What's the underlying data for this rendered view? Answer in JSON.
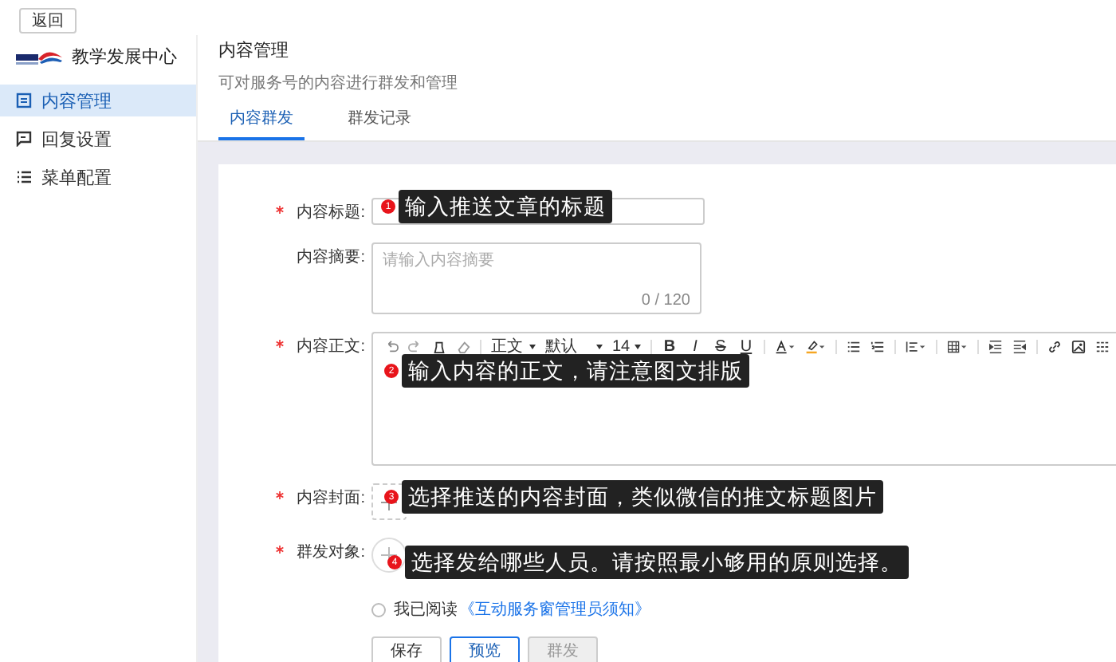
{
  "back_button": "返回",
  "brand": {
    "name": "教学发展中心"
  },
  "sidebar": {
    "items": [
      {
        "label": "内容管理",
        "selected": true
      },
      {
        "label": "回复设置",
        "selected": false
      },
      {
        "label": "菜单配置",
        "selected": false
      }
    ]
  },
  "header": {
    "title": "内容管理",
    "subtitle": "可对服务号的内容进行群发和管理"
  },
  "tabs": [
    {
      "label": "内容群发",
      "selected": true
    },
    {
      "label": "群发记录",
      "selected": false
    }
  ],
  "form": {
    "fields": [
      {
        "kind": "text",
        "label": "内容标题:",
        "required": true,
        "callout": {
          "number": "1",
          "text": "输入推送文章的标题"
        }
      },
      {
        "kind": "textarea",
        "label": "内容摘要:",
        "required": false,
        "placeholder": "请输入内容摘要",
        "counter": "0 / 120"
      },
      {
        "kind": "editor",
        "label": "内容正文:",
        "required": true,
        "toolbar": {
          "paragraph": "正文",
          "font": "默认",
          "size": "14",
          "format": [
            "B",
            "I",
            "S",
            "U"
          ]
        },
        "callout": {
          "number": "2",
          "text": "输入内容的正文，请注意图文排版"
        }
      },
      {
        "kind": "upload",
        "label": "内容封面:",
        "required": true,
        "callout": {
          "number": "3",
          "text": "选择推送的内容封面，类似微信的推文标题图片"
        }
      },
      {
        "kind": "picker",
        "label": "群发对象:",
        "required": true,
        "callout": {
          "number": "4",
          "text": "选择发给哪些人员。请按照最小够用的原则选择。"
        }
      }
    ],
    "agreement": {
      "checked": false,
      "text": "我已阅读",
      "link": "《互动服务窗管理员须知》"
    },
    "buttons": [
      {
        "label": "保存",
        "kind": "default"
      },
      {
        "label": "预览",
        "kind": "primary"
      },
      {
        "label": "群发",
        "kind": "disabled"
      }
    ]
  }
}
